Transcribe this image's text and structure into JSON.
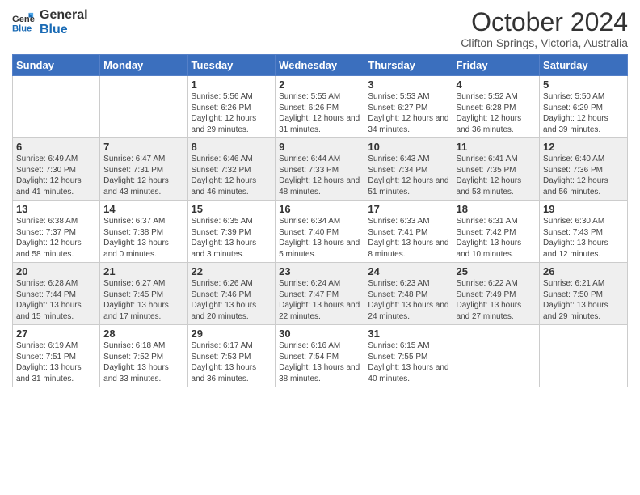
{
  "header": {
    "logo_line1": "General",
    "logo_line2": "Blue",
    "month": "October 2024",
    "location": "Clifton Springs, Victoria, Australia"
  },
  "weekdays": [
    "Sunday",
    "Monday",
    "Tuesday",
    "Wednesday",
    "Thursday",
    "Friday",
    "Saturday"
  ],
  "weeks": [
    [
      {
        "day": "",
        "info": ""
      },
      {
        "day": "",
        "info": ""
      },
      {
        "day": "1",
        "info": "Sunrise: 5:56 AM\nSunset: 6:26 PM\nDaylight: 12 hours and 29 minutes."
      },
      {
        "day": "2",
        "info": "Sunrise: 5:55 AM\nSunset: 6:26 PM\nDaylight: 12 hours and 31 minutes."
      },
      {
        "day": "3",
        "info": "Sunrise: 5:53 AM\nSunset: 6:27 PM\nDaylight: 12 hours and 34 minutes."
      },
      {
        "day": "4",
        "info": "Sunrise: 5:52 AM\nSunset: 6:28 PM\nDaylight: 12 hours and 36 minutes."
      },
      {
        "day": "5",
        "info": "Sunrise: 5:50 AM\nSunset: 6:29 PM\nDaylight: 12 hours and 39 minutes."
      }
    ],
    [
      {
        "day": "6",
        "info": "Sunrise: 6:49 AM\nSunset: 7:30 PM\nDaylight: 12 hours and 41 minutes."
      },
      {
        "day": "7",
        "info": "Sunrise: 6:47 AM\nSunset: 7:31 PM\nDaylight: 12 hours and 43 minutes."
      },
      {
        "day": "8",
        "info": "Sunrise: 6:46 AM\nSunset: 7:32 PM\nDaylight: 12 hours and 46 minutes."
      },
      {
        "day": "9",
        "info": "Sunrise: 6:44 AM\nSunset: 7:33 PM\nDaylight: 12 hours and 48 minutes."
      },
      {
        "day": "10",
        "info": "Sunrise: 6:43 AM\nSunset: 7:34 PM\nDaylight: 12 hours and 51 minutes."
      },
      {
        "day": "11",
        "info": "Sunrise: 6:41 AM\nSunset: 7:35 PM\nDaylight: 12 hours and 53 minutes."
      },
      {
        "day": "12",
        "info": "Sunrise: 6:40 AM\nSunset: 7:36 PM\nDaylight: 12 hours and 56 minutes."
      }
    ],
    [
      {
        "day": "13",
        "info": "Sunrise: 6:38 AM\nSunset: 7:37 PM\nDaylight: 12 hours and 58 minutes."
      },
      {
        "day": "14",
        "info": "Sunrise: 6:37 AM\nSunset: 7:38 PM\nDaylight: 13 hours and 0 minutes."
      },
      {
        "day": "15",
        "info": "Sunrise: 6:35 AM\nSunset: 7:39 PM\nDaylight: 13 hours and 3 minutes."
      },
      {
        "day": "16",
        "info": "Sunrise: 6:34 AM\nSunset: 7:40 PM\nDaylight: 13 hours and 5 minutes."
      },
      {
        "day": "17",
        "info": "Sunrise: 6:33 AM\nSunset: 7:41 PM\nDaylight: 13 hours and 8 minutes."
      },
      {
        "day": "18",
        "info": "Sunrise: 6:31 AM\nSunset: 7:42 PM\nDaylight: 13 hours and 10 minutes."
      },
      {
        "day": "19",
        "info": "Sunrise: 6:30 AM\nSunset: 7:43 PM\nDaylight: 13 hours and 12 minutes."
      }
    ],
    [
      {
        "day": "20",
        "info": "Sunrise: 6:28 AM\nSunset: 7:44 PM\nDaylight: 13 hours and 15 minutes."
      },
      {
        "day": "21",
        "info": "Sunrise: 6:27 AM\nSunset: 7:45 PM\nDaylight: 13 hours and 17 minutes."
      },
      {
        "day": "22",
        "info": "Sunrise: 6:26 AM\nSunset: 7:46 PM\nDaylight: 13 hours and 20 minutes."
      },
      {
        "day": "23",
        "info": "Sunrise: 6:24 AM\nSunset: 7:47 PM\nDaylight: 13 hours and 22 minutes."
      },
      {
        "day": "24",
        "info": "Sunrise: 6:23 AM\nSunset: 7:48 PM\nDaylight: 13 hours and 24 minutes."
      },
      {
        "day": "25",
        "info": "Sunrise: 6:22 AM\nSunset: 7:49 PM\nDaylight: 13 hours and 27 minutes."
      },
      {
        "day": "26",
        "info": "Sunrise: 6:21 AM\nSunset: 7:50 PM\nDaylight: 13 hours and 29 minutes."
      }
    ],
    [
      {
        "day": "27",
        "info": "Sunrise: 6:19 AM\nSunset: 7:51 PM\nDaylight: 13 hours and 31 minutes."
      },
      {
        "day": "28",
        "info": "Sunrise: 6:18 AM\nSunset: 7:52 PM\nDaylight: 13 hours and 33 minutes."
      },
      {
        "day": "29",
        "info": "Sunrise: 6:17 AM\nSunset: 7:53 PM\nDaylight: 13 hours and 36 minutes."
      },
      {
        "day": "30",
        "info": "Sunrise: 6:16 AM\nSunset: 7:54 PM\nDaylight: 13 hours and 38 minutes."
      },
      {
        "day": "31",
        "info": "Sunrise: 6:15 AM\nSunset: 7:55 PM\nDaylight: 13 hours and 40 minutes."
      },
      {
        "day": "",
        "info": ""
      },
      {
        "day": "",
        "info": ""
      }
    ]
  ]
}
